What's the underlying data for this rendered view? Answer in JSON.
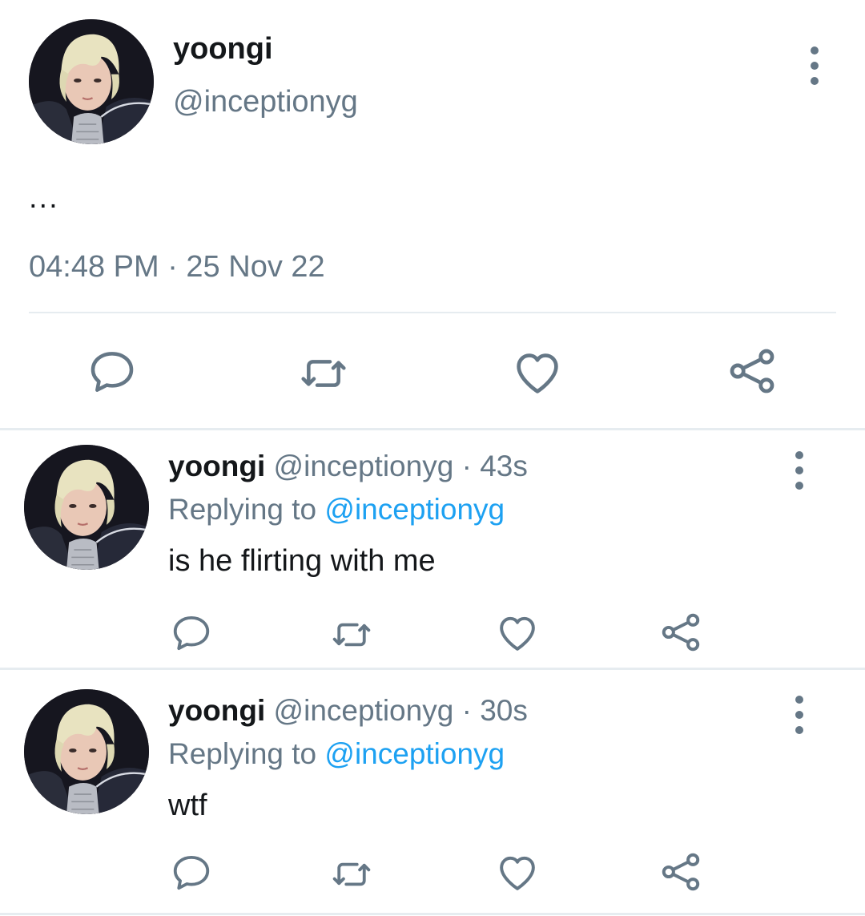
{
  "main_tweet": {
    "author_name": "yoongi",
    "author_handle": "@inceptionyg",
    "text": "...",
    "timestamp": "04:48 PM · 25 Nov 22",
    "actions": [
      "reply-icon",
      "retweet-icon",
      "like-icon",
      "share-icon"
    ]
  },
  "replies": [
    {
      "author_name": "yoongi",
      "author_handle": "@inceptionyg",
      "separator": " · ",
      "age": "43s",
      "replying_prefix": "Replying to ",
      "replying_to": "@inceptionyg",
      "text": "is he flirting with me"
    },
    {
      "author_name": "yoongi",
      "author_handle": "@inceptionyg",
      "separator": " · ",
      "age": "30s",
      "replying_prefix": "Replying to ",
      "replying_to": "@inceptionyg",
      "text": "wtf"
    }
  ],
  "colors": {
    "text_primary": "#14171a",
    "text_secondary": "#657786",
    "mention": "#1da1f2",
    "divider": "#e6ecf0"
  }
}
